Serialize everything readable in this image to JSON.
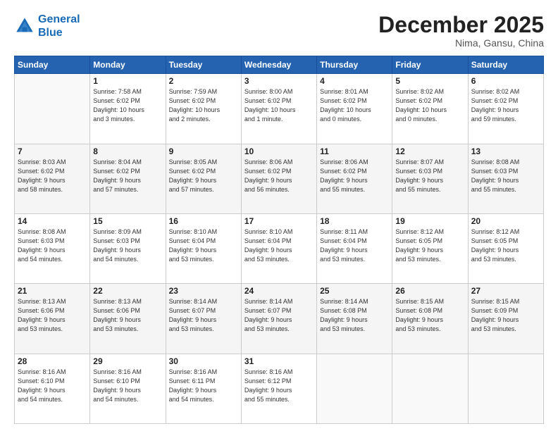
{
  "header": {
    "logo_line1": "General",
    "logo_line2": "Blue",
    "month": "December 2025",
    "location": "Nima, Gansu, China"
  },
  "weekdays": [
    "Sunday",
    "Monday",
    "Tuesday",
    "Wednesday",
    "Thursday",
    "Friday",
    "Saturday"
  ],
  "weeks": [
    [
      {
        "day": "",
        "info": ""
      },
      {
        "day": "1",
        "info": "Sunrise: 7:58 AM\nSunset: 6:02 PM\nDaylight: 10 hours\nand 3 minutes."
      },
      {
        "day": "2",
        "info": "Sunrise: 7:59 AM\nSunset: 6:02 PM\nDaylight: 10 hours\nand 2 minutes."
      },
      {
        "day": "3",
        "info": "Sunrise: 8:00 AM\nSunset: 6:02 PM\nDaylight: 10 hours\nand 1 minute."
      },
      {
        "day": "4",
        "info": "Sunrise: 8:01 AM\nSunset: 6:02 PM\nDaylight: 10 hours\nand 0 minutes."
      },
      {
        "day": "5",
        "info": "Sunrise: 8:02 AM\nSunset: 6:02 PM\nDaylight: 10 hours\nand 0 minutes."
      },
      {
        "day": "6",
        "info": "Sunrise: 8:02 AM\nSunset: 6:02 PM\nDaylight: 9 hours\nand 59 minutes."
      }
    ],
    [
      {
        "day": "7",
        "info": "Sunrise: 8:03 AM\nSunset: 6:02 PM\nDaylight: 9 hours\nand 58 minutes."
      },
      {
        "day": "8",
        "info": "Sunrise: 8:04 AM\nSunset: 6:02 PM\nDaylight: 9 hours\nand 57 minutes."
      },
      {
        "day": "9",
        "info": "Sunrise: 8:05 AM\nSunset: 6:02 PM\nDaylight: 9 hours\nand 57 minutes."
      },
      {
        "day": "10",
        "info": "Sunrise: 8:06 AM\nSunset: 6:02 PM\nDaylight: 9 hours\nand 56 minutes."
      },
      {
        "day": "11",
        "info": "Sunrise: 8:06 AM\nSunset: 6:02 PM\nDaylight: 9 hours\nand 55 minutes."
      },
      {
        "day": "12",
        "info": "Sunrise: 8:07 AM\nSunset: 6:03 PM\nDaylight: 9 hours\nand 55 minutes."
      },
      {
        "day": "13",
        "info": "Sunrise: 8:08 AM\nSunset: 6:03 PM\nDaylight: 9 hours\nand 55 minutes."
      }
    ],
    [
      {
        "day": "14",
        "info": "Sunrise: 8:08 AM\nSunset: 6:03 PM\nDaylight: 9 hours\nand 54 minutes."
      },
      {
        "day": "15",
        "info": "Sunrise: 8:09 AM\nSunset: 6:03 PM\nDaylight: 9 hours\nand 54 minutes."
      },
      {
        "day": "16",
        "info": "Sunrise: 8:10 AM\nSunset: 6:04 PM\nDaylight: 9 hours\nand 53 minutes."
      },
      {
        "day": "17",
        "info": "Sunrise: 8:10 AM\nSunset: 6:04 PM\nDaylight: 9 hours\nand 53 minutes."
      },
      {
        "day": "18",
        "info": "Sunrise: 8:11 AM\nSunset: 6:04 PM\nDaylight: 9 hours\nand 53 minutes."
      },
      {
        "day": "19",
        "info": "Sunrise: 8:12 AM\nSunset: 6:05 PM\nDaylight: 9 hours\nand 53 minutes."
      },
      {
        "day": "20",
        "info": "Sunrise: 8:12 AM\nSunset: 6:05 PM\nDaylight: 9 hours\nand 53 minutes."
      }
    ],
    [
      {
        "day": "21",
        "info": "Sunrise: 8:13 AM\nSunset: 6:06 PM\nDaylight: 9 hours\nand 53 minutes."
      },
      {
        "day": "22",
        "info": "Sunrise: 8:13 AM\nSunset: 6:06 PM\nDaylight: 9 hours\nand 53 minutes."
      },
      {
        "day": "23",
        "info": "Sunrise: 8:14 AM\nSunset: 6:07 PM\nDaylight: 9 hours\nand 53 minutes."
      },
      {
        "day": "24",
        "info": "Sunrise: 8:14 AM\nSunset: 6:07 PM\nDaylight: 9 hours\nand 53 minutes."
      },
      {
        "day": "25",
        "info": "Sunrise: 8:14 AM\nSunset: 6:08 PM\nDaylight: 9 hours\nand 53 minutes."
      },
      {
        "day": "26",
        "info": "Sunrise: 8:15 AM\nSunset: 6:08 PM\nDaylight: 9 hours\nand 53 minutes."
      },
      {
        "day": "27",
        "info": "Sunrise: 8:15 AM\nSunset: 6:09 PM\nDaylight: 9 hours\nand 53 minutes."
      }
    ],
    [
      {
        "day": "28",
        "info": "Sunrise: 8:16 AM\nSunset: 6:10 PM\nDaylight: 9 hours\nand 54 minutes."
      },
      {
        "day": "29",
        "info": "Sunrise: 8:16 AM\nSunset: 6:10 PM\nDaylight: 9 hours\nand 54 minutes."
      },
      {
        "day": "30",
        "info": "Sunrise: 8:16 AM\nSunset: 6:11 PM\nDaylight: 9 hours\nand 54 minutes."
      },
      {
        "day": "31",
        "info": "Sunrise: 8:16 AM\nSunset: 6:12 PM\nDaylight: 9 hours\nand 55 minutes."
      },
      {
        "day": "",
        "info": ""
      },
      {
        "day": "",
        "info": ""
      },
      {
        "day": "",
        "info": ""
      }
    ]
  ]
}
